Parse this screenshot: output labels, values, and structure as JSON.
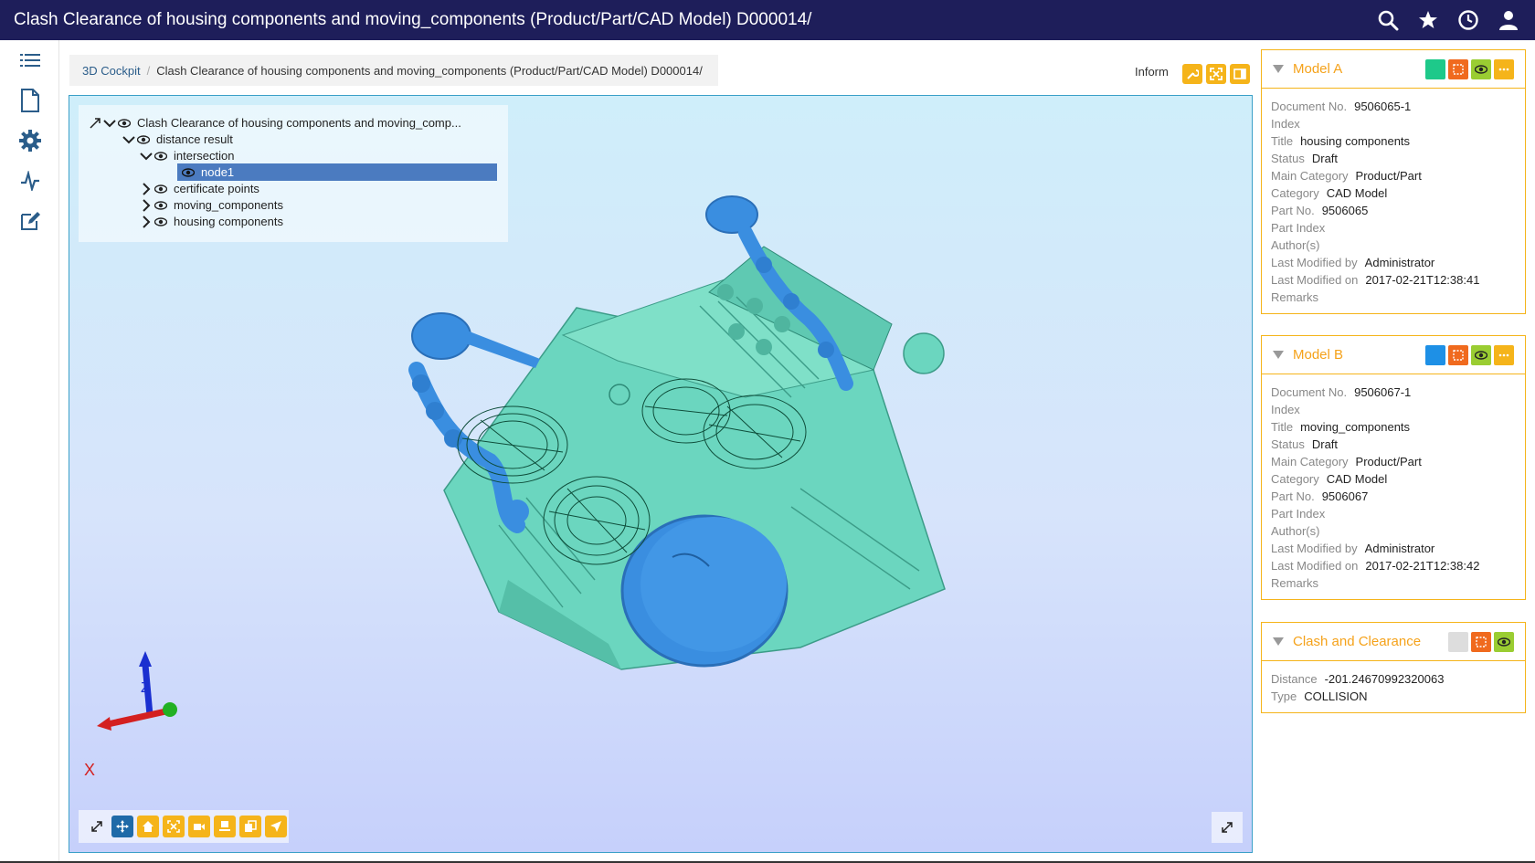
{
  "header": {
    "title": "Clash Clearance of housing components and moving_components (Product/Part/CAD Model) D000014/",
    "icons": [
      "search-icon",
      "star-icon",
      "clock-icon",
      "user-icon"
    ]
  },
  "leftnav": {
    "icons": [
      "list-icon",
      "document-icon",
      "gear-icon",
      "pulse-icon",
      "edit-icon"
    ]
  },
  "breadcrumb": {
    "root": "3D Cockpit",
    "separator": "/",
    "current": "Clash Clearance of housing components and moving_components (Product/Part/CAD Model) D000014/"
  },
  "viewer": {
    "inform_label": "Inform",
    "tree": [
      {
        "label": "Clash Clearance of housing components and moving_comp...",
        "depth": 0,
        "expanded": true
      },
      {
        "label": "distance result",
        "depth": 1,
        "expanded": true
      },
      {
        "label": "intersection",
        "depth": 2,
        "expanded": true
      },
      {
        "label": "node1",
        "depth": 3,
        "selected": true
      },
      {
        "label": "certificate points",
        "depth": 2,
        "expanded": false
      },
      {
        "label": "moving_components",
        "depth": 2,
        "expanded": false
      },
      {
        "label": "housing components",
        "depth": 2,
        "expanded": false
      }
    ],
    "axes": {
      "z": "Z",
      "x": "X"
    }
  },
  "model_a": {
    "title": "Model A",
    "color": "#1ec98a",
    "fields": [
      {
        "label": "Document No.",
        "value": "9506065-1"
      },
      {
        "label": "Index",
        "value": ""
      },
      {
        "label": "Title",
        "value": "housing components"
      },
      {
        "label": "Status",
        "value": "Draft"
      },
      {
        "label": "Main Category",
        "value": "Product/Part"
      },
      {
        "label": "Category",
        "value": "CAD Model"
      },
      {
        "label": "Part No.",
        "value": "9506065"
      },
      {
        "label": "Part Index",
        "value": ""
      },
      {
        "label": "Author(s)",
        "value": ""
      },
      {
        "label": "Last Modified by",
        "value": "Administrator"
      },
      {
        "label": "Last Modified on",
        "value": "2017-02-21T12:38:41"
      },
      {
        "label": "Remarks",
        "value": ""
      }
    ]
  },
  "model_b": {
    "title": "Model B",
    "color": "#1e90e6",
    "fields": [
      {
        "label": "Document No.",
        "value": "9506067-1"
      },
      {
        "label": "Index",
        "value": ""
      },
      {
        "label": "Title",
        "value": "moving_components"
      },
      {
        "label": "Status",
        "value": "Draft"
      },
      {
        "label": "Main Category",
        "value": "Product/Part"
      },
      {
        "label": "Category",
        "value": "CAD Model"
      },
      {
        "label": "Part No.",
        "value": "9506067"
      },
      {
        "label": "Part Index",
        "value": ""
      },
      {
        "label": "Author(s)",
        "value": ""
      },
      {
        "label": "Last Modified by",
        "value": "Administrator"
      },
      {
        "label": "Last Modified on",
        "value": "2017-02-21T12:38:42"
      },
      {
        "label": "Remarks",
        "value": ""
      }
    ]
  },
  "clash": {
    "title": "Clash and Clearance",
    "color": "#dddddd",
    "fields": [
      {
        "label": "Distance",
        "value": "-201.24670992320063"
      },
      {
        "label": "Type",
        "value": "COLLISION"
      }
    ]
  },
  "colors": {
    "header_bg": "#1e1e5a",
    "accent": "#f5b41a",
    "orange": "#f06a1e",
    "lime": "#9acd32",
    "selection": "#4b7bc0"
  }
}
